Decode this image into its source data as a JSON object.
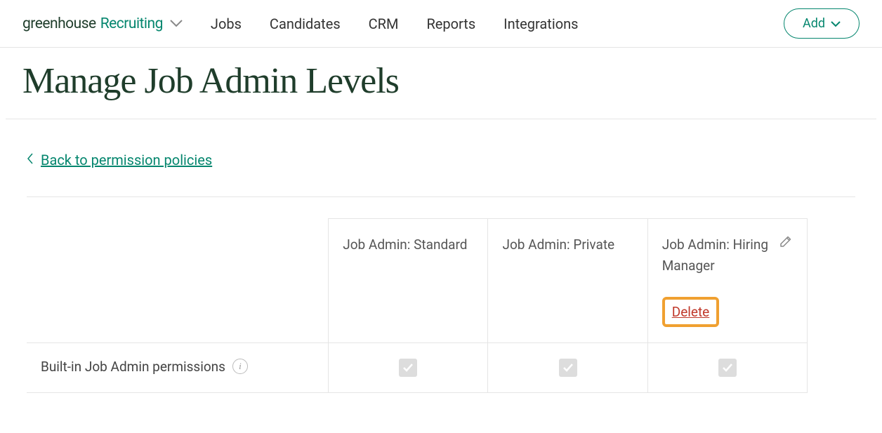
{
  "brand": {
    "part1": "greenhouse",
    "part2": "Recruiting"
  },
  "nav": {
    "jobs": "Jobs",
    "candidates": "Candidates",
    "crm": "CRM",
    "reports": "Reports",
    "integrations": "Integrations"
  },
  "add_btn": "Add",
  "page_title": "Manage Job Admin Levels",
  "back_link": "Back to permission policies",
  "cols": {
    "standard": "Job Admin: Standard",
    "private": "Job Admin: Private",
    "hiring_manager": "Job Admin: Hiring Manager",
    "delete": "Delete"
  },
  "rows": {
    "builtin": "Built-in Job Admin permissions"
  }
}
